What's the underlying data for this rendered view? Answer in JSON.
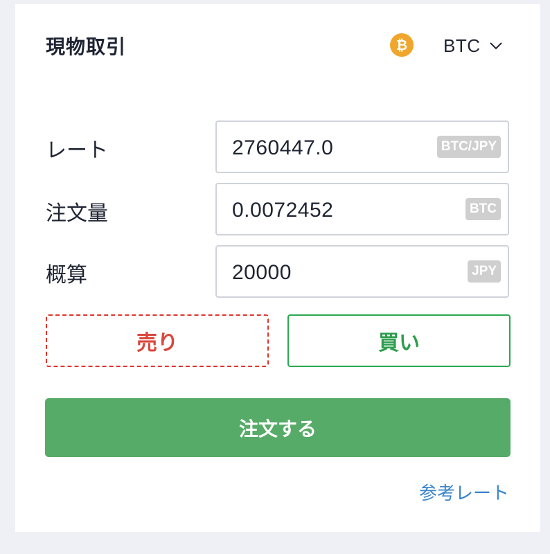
{
  "header": {
    "title": "現物取引",
    "coin_icon_glyph": "₿",
    "currency": "BTC"
  },
  "form": {
    "rate": {
      "label": "レート",
      "value": "2760447.0",
      "unit": "BTC/JPY"
    },
    "amount": {
      "label": "注文量",
      "value": "0.0072452",
      "unit": "BTC"
    },
    "estimate": {
      "label": "概算",
      "value": "20000",
      "unit": "JPY"
    }
  },
  "actions": {
    "sell_label": "売り",
    "buy_label": "買い",
    "order_label": "注文する",
    "reference_rate_label": "参考レート"
  },
  "colors": {
    "sell": "#e0342d",
    "buy": "#2aa84f",
    "order_button": "#57ab68",
    "link": "#3a84c9",
    "btc_icon": "#f0a62d"
  }
}
